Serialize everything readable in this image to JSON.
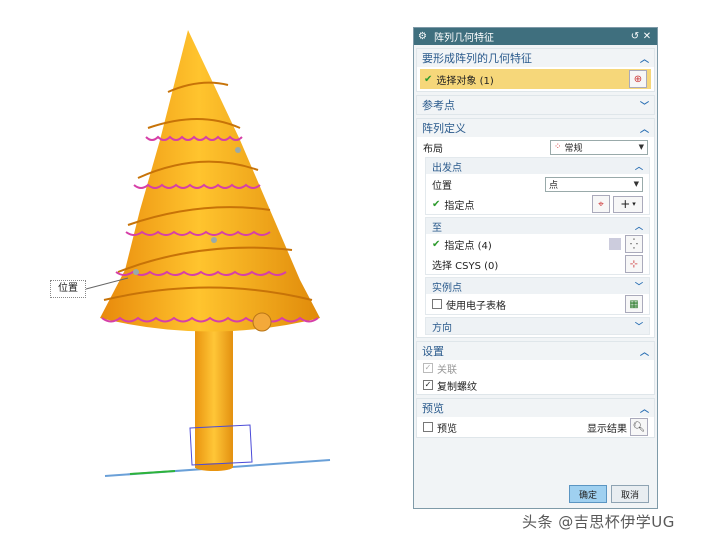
{
  "viewport": {
    "callout_label": "位置"
  },
  "dialog": {
    "title": "阵列几何特征",
    "sections": {
      "geometry": {
        "header": "要形成阵列的几何特征",
        "select_label": "选择对象 (1)"
      },
      "reference": {
        "header": "参考点"
      },
      "pattern_def": {
        "header": "阵列定义",
        "layout_label": "布局",
        "layout_value": "常规",
        "from": {
          "header": "出发点",
          "position_label": "位置",
          "position_value": "点",
          "specify_point_label": "指定点"
        },
        "to": {
          "header": "至",
          "specify_point_label": "指定点 (4)",
          "select_csys_label": "选择 CSYS (0)"
        },
        "instance": {
          "header": "实例点",
          "use_spreadsheet_label": "使用电子表格"
        },
        "direction": {
          "header": "方向"
        }
      },
      "settings": {
        "header": "设置",
        "associative_label": "关联",
        "copy_threads_label": "复制螺纹"
      },
      "preview": {
        "header": "预览",
        "preview_label": "预览",
        "show_result_label": "显示结果"
      }
    },
    "buttons": {
      "ok": "确定",
      "cancel": "取消"
    }
  },
  "watermark": "头条 @吉思杯伊学UG",
  "colors": {
    "titlebar": "#3f6f7e",
    "selected_row": "#f6d77a",
    "tree_body": "#f5a81a",
    "tree_edge": "#d63fa8",
    "header_text": "#2a5a8c"
  }
}
